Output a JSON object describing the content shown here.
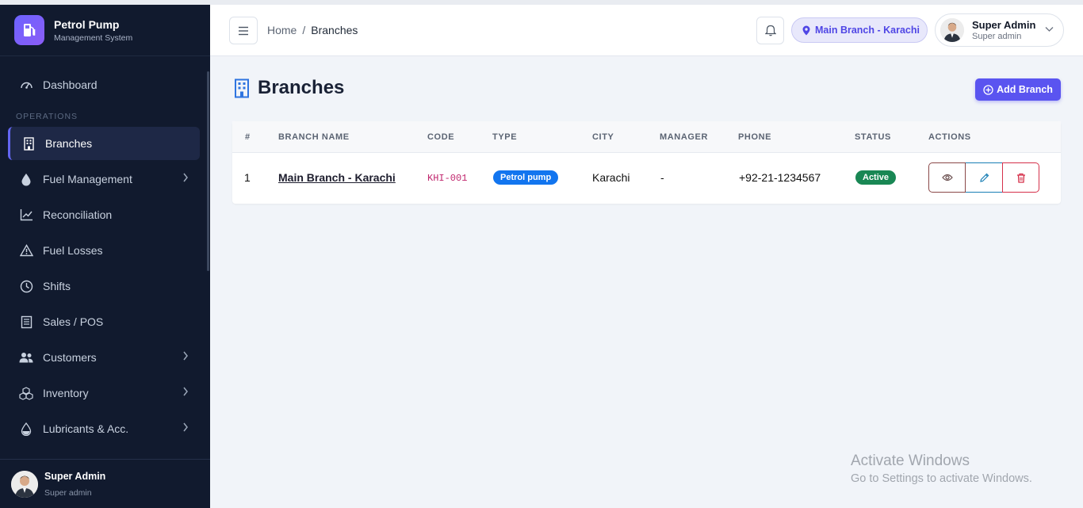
{
  "brand": {
    "title": "Petrol Pump",
    "subtitle": "Management System"
  },
  "sidebar": {
    "section_label": "OPERATIONS",
    "items": [
      {
        "label": "Dashboard"
      },
      {
        "label": "Branches"
      },
      {
        "label": "Fuel Management"
      },
      {
        "label": "Reconciliation"
      },
      {
        "label": "Fuel Losses"
      },
      {
        "label": "Shifts"
      },
      {
        "label": "Sales / POS"
      },
      {
        "label": "Customers"
      },
      {
        "label": "Inventory"
      },
      {
        "label": "Lubricants & Acc."
      }
    ],
    "user": {
      "name": "Super Admin",
      "role": "Super admin"
    }
  },
  "header": {
    "breadcrumb": {
      "home": "Home",
      "separator": "/",
      "current": "Branches"
    },
    "branch_selector": "Main Branch - Karachi",
    "user": {
      "name": "Super Admin",
      "role": "Super admin"
    }
  },
  "main": {
    "title": "Branches",
    "add_button": "Add Branch",
    "table": {
      "headers": [
        "#",
        "BRANCH NAME",
        "CODE",
        "TYPE",
        "CITY",
        "MANAGER",
        "PHONE",
        "STATUS",
        "ACTIONS"
      ],
      "rows": [
        {
          "num": "1",
          "name": "Main Branch - Karachi",
          "code": "KHI-001",
          "type": "Petrol pump",
          "city": "Karachi",
          "manager": "-",
          "phone": "+92-21-1234567",
          "status": "Active"
        }
      ]
    }
  },
  "watermark": {
    "line1": "Activate Windows",
    "line2": "Go to Settings to activate Windows."
  },
  "colors": {
    "sidebar_bg": "#111a2e",
    "accent": "#5a54f0",
    "active_status": "#198754",
    "type_badge": "#1275ef"
  }
}
